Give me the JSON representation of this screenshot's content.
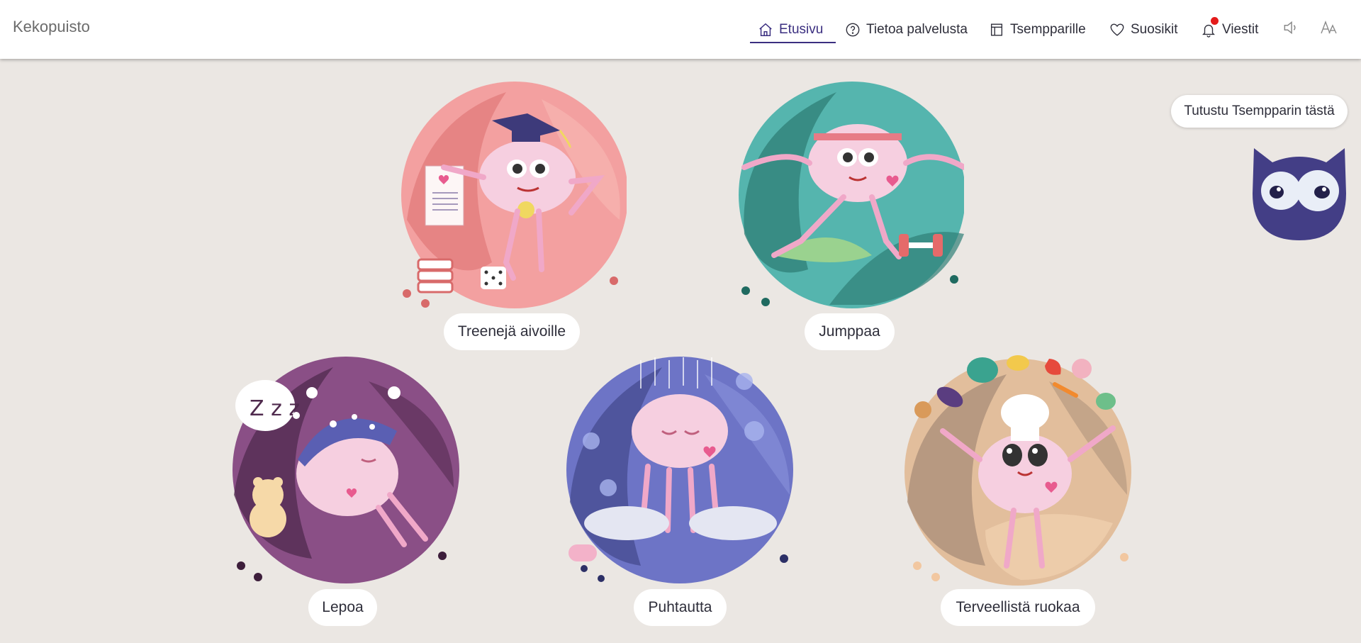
{
  "header": {
    "brand": "Kekopuisto",
    "nav": {
      "home": "Etusivu",
      "about": "Tietoa palvelusta",
      "tsemppari": "Tsempparille",
      "favorites": "Suosikit",
      "messages": "Viestit"
    },
    "icons": {
      "home": "home-icon",
      "about": "question-circle-icon",
      "tsemppari": "calendar-icon",
      "favorites": "heart-icon",
      "messages": "bell-icon",
      "sound": "speaker-icon",
      "text_size": "text-size-icon"
    },
    "notification_color": "#e41b1b",
    "active_color": "#3b2f80"
  },
  "helper": {
    "bubble": "Tutustu Tsempparin tästä",
    "owl_color": "#433e86"
  },
  "categories": [
    {
      "label": "Treenejä aivoille",
      "color": "#ec8585"
    },
    {
      "label": "Jumppaa",
      "color": "#3f9f94"
    },
    {
      "label": "Lepoa",
      "color": "#6b3a65"
    },
    {
      "label": "Puhtautta",
      "color": "#6468b6"
    },
    {
      "label": "Terveellistä ruokaa",
      "color": "#c9a688"
    }
  ]
}
